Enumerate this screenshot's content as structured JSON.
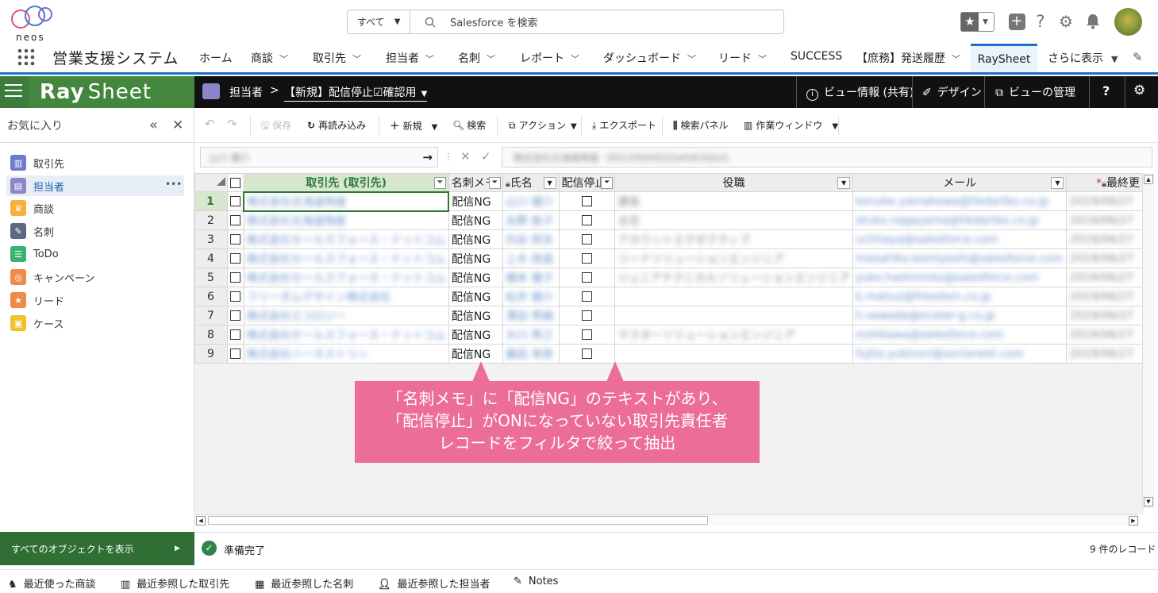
{
  "header": {
    "search_scope": "すべて",
    "search_placeholder": "Salesforce を検索",
    "logo_text": "neos"
  },
  "nav": {
    "app_name": "営業支援システム",
    "items": [
      "ホーム",
      "商談",
      "取引先",
      "担当者",
      "名刺",
      "レポート",
      "ダッシュボード",
      "リード",
      "SUCCESS",
      "【庶務】発送履歴",
      "RaySheet",
      "さらに表示"
    ]
  },
  "sidebar": {
    "logo_ray": "Ray",
    "logo_sheet": "Sheet",
    "favorites_title": "お気に入り",
    "items": [
      {
        "label": "取引先",
        "color": "#6f7ccb",
        "icon": "account-icon"
      },
      {
        "label": "担当者",
        "color": "#8b86c9",
        "icon": "contact-icon"
      },
      {
        "label": "商談",
        "color": "#f4b13d",
        "icon": "opportunity-icon"
      },
      {
        "label": "名刺",
        "color": "#5a6b7d",
        "icon": "wrench-icon"
      },
      {
        "label": "ToDo",
        "color": "#3bb36f",
        "icon": "todo-icon"
      },
      {
        "label": "キャンペーン",
        "color": "#f0894a",
        "icon": "campaign-icon"
      },
      {
        "label": "リード",
        "color": "#f0894a",
        "icon": "lead-icon"
      },
      {
        "label": "ケース",
        "color": "#f2c12e",
        "icon": "case-icon"
      }
    ],
    "more": "•••",
    "all_objects": "すべてのオブジェクトを表示"
  },
  "viewbar": {
    "object": "担当者",
    "separator": ">",
    "view_name": "【新規】配信停止☑確認用",
    "view_info": "ビュー情報 (共有)",
    "design": "デザイン",
    "manage": "ビューの管理",
    "help": "?"
  },
  "toolbar": {
    "save": "保存",
    "reload": "再読み込み",
    "new": "新規",
    "search": "検索",
    "action": "アクション",
    "export": "エクスポート",
    "search_panel": "検索パネル",
    "work_window": "作業ウィンドウ"
  },
  "formula": {
    "namebox": "山川 健介",
    "value": "株式会社北海道物産（0012000002Zwfo63QAA）"
  },
  "grid": {
    "columns": [
      "取引先 (取引先)",
      "名刺メモ",
      "氏名",
      "配信停止",
      "役職",
      "メール",
      "最終更"
    ],
    "rows": [
      {
        "n": "1",
        "account": "株式会社北海道物産",
        "memo": "配信NG",
        "name": "山川 健介",
        "title": "課長",
        "email": "kenuke.yamakawa@hkdartko.co.jp",
        "date": "2019/06/27"
      },
      {
        "n": "2",
        "account": "株式会社北海道物産",
        "memo": "配信NG",
        "name": "永野 敦子",
        "title": "主任",
        "email": "atuko.nagayama@hkdartko.co.jp",
        "date": "2019/06/27"
      },
      {
        "n": "3",
        "account": "株式会社セールスフォース・ドットコム",
        "memo": "配信NG",
        "name": "内谷 邦夫",
        "title": "アカウントエグゼクティブ",
        "email": "uchitaya@salesforce.com",
        "date": "2019/06/27"
      },
      {
        "n": "4",
        "account": "株式会社セールスフォース・ドットコム",
        "memo": "配信NG",
        "name": "上木 政昌",
        "title": "リードソリューションエンジニア",
        "email": "masahiko.komiyoshi@salesforce.com",
        "date": "2019/06/27"
      },
      {
        "n": "5",
        "account": "株式会社セールスフォース・ドットコム",
        "memo": "配信NG",
        "name": "橋本 優子",
        "title": "ジュニアテクニカルソリューションエンジニア",
        "email": "yuko.hashimoto@salesforce.com",
        "date": "2019/06/27"
      },
      {
        "n": "6",
        "account": "フリーダムデザイン株式会社",
        "memo": "配信NG",
        "name": "松井 健介",
        "title": "",
        "email": "k.matsui@freedom.co.jp",
        "date": "2019/06/27"
      },
      {
        "n": "7",
        "account": "株式会社エコロジー",
        "memo": "配信NG",
        "name": "澤田 秀樹",
        "title": "",
        "email": "h.sawada@ecoter-g.co.jp",
        "date": "2019/06/27"
      },
      {
        "n": "8",
        "account": "株式会社セールスフォース・ドットコム",
        "memo": "配信NG",
        "name": "大川 秀之",
        "title": "マスターソリューションエンジニア",
        "email": "mohkawa@salesforce.com",
        "date": "2019/06/27"
      },
      {
        "n": "9",
        "account": "株式会社ハーネストリン",
        "memo": "配信NG",
        "name": "藤田 幸郎",
        "title": "",
        "email": "fujita.yukinori@socionext.com",
        "date": "2019/06/27"
      }
    ]
  },
  "status": {
    "text": "準備完了",
    "count": "9 件のレコード"
  },
  "footer": [
    "最近使った商談",
    "最近参照した取引先",
    "最近参照した名刺",
    "最近参照した担当者",
    "Notes"
  ],
  "callout": {
    "line1": "「名刺メモ」に「配信NG」のテキストがあり、",
    "line2": "「配信停止」がONになっていない取引先責任者",
    "line3": "レコードをフィルタで絞って抽出"
  },
  "colors": {
    "accent": "#1b72c6",
    "raysheet_green": "#43873f",
    "callout": "#ec6e98"
  }
}
